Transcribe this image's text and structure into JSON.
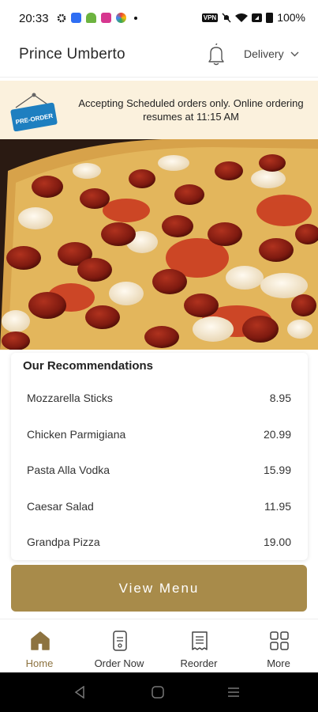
{
  "status": {
    "time": "20:33",
    "battery": "100%",
    "vpn_label": "VPN"
  },
  "header": {
    "restaurant_name": "Prince Umberto",
    "mode": "Delivery"
  },
  "banner": {
    "sign_label": "PRE-ORDER",
    "message": "Accepting Scheduled orders only. Online ordering resumes at 11:15 AM"
  },
  "recommendations": {
    "title": "Our Recommendations",
    "items": [
      {
        "name": "Mozzarella Sticks",
        "price": "8.95"
      },
      {
        "name": "Chicken Parmigiana",
        "price": "20.99"
      },
      {
        "name": "Pasta Alla Vodka",
        "price": "15.99"
      },
      {
        "name": "Caesar Salad",
        "price": "11.95"
      },
      {
        "name": "Grandpa Pizza",
        "price": "19.00"
      }
    ]
  },
  "view_menu_label": "View Menu",
  "nav": {
    "items": [
      {
        "label": "Home",
        "icon": "home-icon",
        "active": true
      },
      {
        "label": "Order Now",
        "icon": "order-icon",
        "active": false
      },
      {
        "label": "Reorder",
        "icon": "receipt-icon",
        "active": false
      },
      {
        "label": "More",
        "icon": "grid-icon",
        "active": false
      }
    ]
  },
  "colors": {
    "accent": "#a88b4a",
    "banner_bg": "#fbf1dd",
    "active_nav": "#8d7340"
  }
}
